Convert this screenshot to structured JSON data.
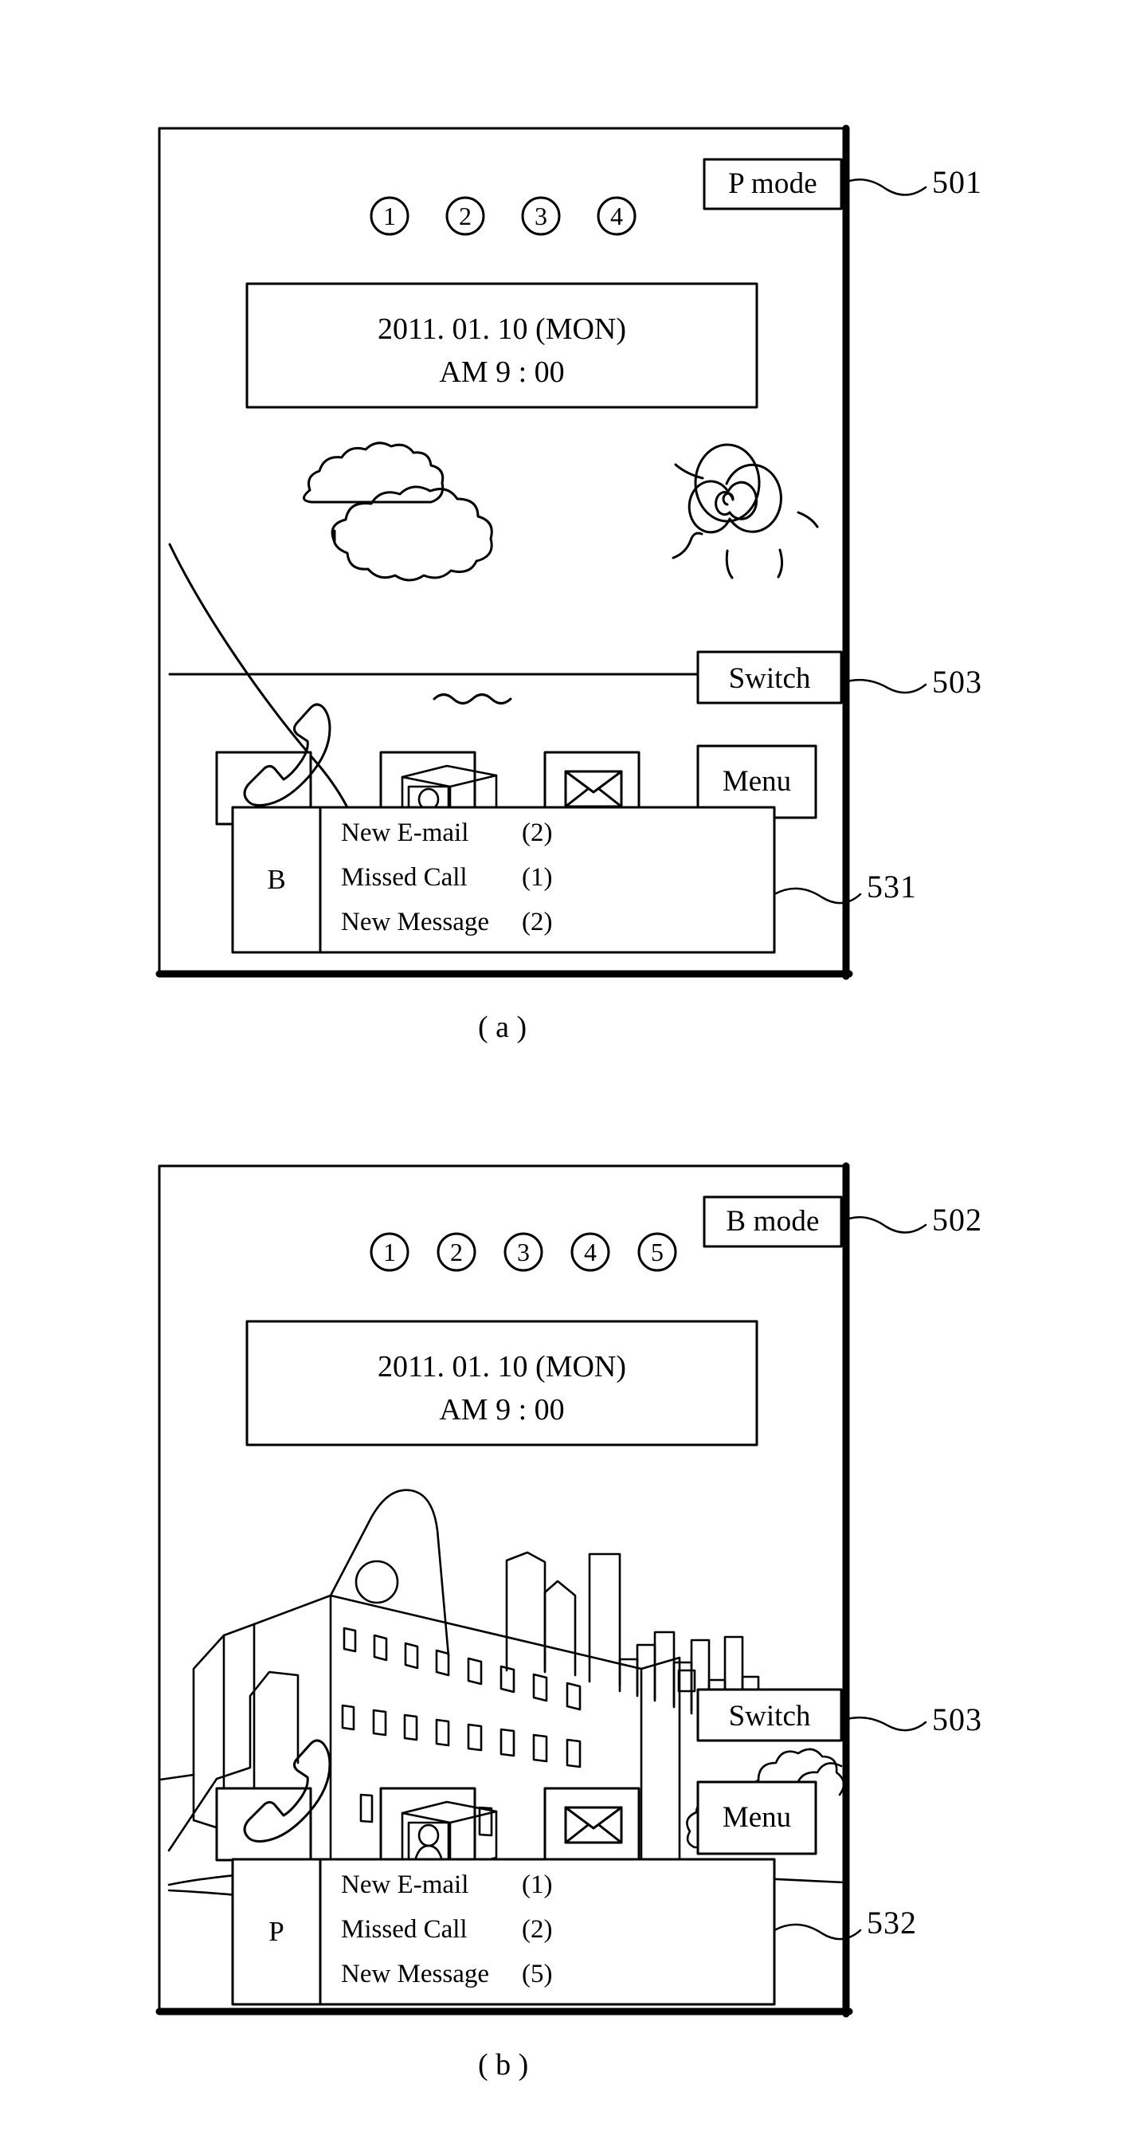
{
  "figure": {
    "title": "Mobile terminal idle screen mode switching figure",
    "panels": [
      {
        "caption": "( a )",
        "mode_button": {
          "label": "P mode",
          "ref": "501"
        },
        "page_indicators": [
          "1",
          "2",
          "3",
          "4"
        ],
        "datetime": {
          "date": "2011. 01. 10 (MON)",
          "time": "AM 9 : 00"
        },
        "wallpaper": "nature-scene-clouds-sun-sea",
        "switch_button": {
          "label": "Switch",
          "ref": "503"
        },
        "toolbar": [
          {
            "name": "call-icon",
            "label": ""
          },
          {
            "name": "contacts-icon",
            "label": ""
          },
          {
            "name": "message-icon",
            "label": ""
          },
          {
            "name": "menu-button",
            "label": "Menu"
          }
        ],
        "notification_panel": {
          "ref": "531",
          "badge": "B",
          "rows": [
            {
              "label": "New E-mail",
              "count": "(2)"
            },
            {
              "label": "Missed Call",
              "count": "(1)"
            },
            {
              "label": "New Message",
              "count": "(2)"
            }
          ]
        }
      },
      {
        "caption": "( b )",
        "mode_button": {
          "label": "B mode",
          "ref": "502"
        },
        "page_indicators": [
          "1",
          "2",
          "3",
          "4",
          "5"
        ],
        "datetime": {
          "date": "2011. 01. 10 (MON)",
          "time": "AM 9 : 00"
        },
        "wallpaper": "city-scene-buildings-trees",
        "switch_button": {
          "label": "Switch",
          "ref": "503"
        },
        "toolbar": [
          {
            "name": "call-icon",
            "label": ""
          },
          {
            "name": "contacts-icon",
            "label": ""
          },
          {
            "name": "message-icon",
            "label": ""
          },
          {
            "name": "menu-button",
            "label": "Menu"
          }
        ],
        "notification_panel": {
          "ref": "532",
          "badge": "P",
          "rows": [
            {
              "label": "New E-mail",
              "count": "(1)"
            },
            {
              "label": "Missed Call",
              "count": "(2)"
            },
            {
              "label": "New Message",
              "count": "(5)"
            }
          ]
        }
      }
    ]
  },
  "colors": {
    "ink": "#000000",
    "paper": "#ffffff"
  }
}
